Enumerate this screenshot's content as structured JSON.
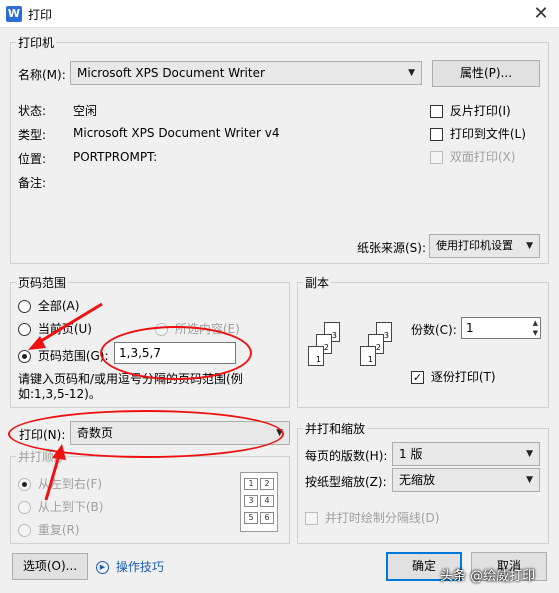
{
  "window": {
    "title": "打印",
    "app_icon": "W"
  },
  "printer": {
    "group_label": "打印机",
    "name_label": "名称(M):",
    "name_value": "Microsoft XPS Document Writer",
    "properties_btn": "属性(P)...",
    "status_label": "状态:",
    "status_value": "空闲",
    "type_label": "类型:",
    "type_value": "Microsoft XPS Document Writer v4",
    "location_label": "位置:",
    "location_value": "PORTPROMPT:",
    "comment_label": "备注:",
    "reverse_print": "反片打印(I)",
    "print_to_file": "打印到文件(L)",
    "duplex": "双面打印(X)",
    "paper_source_label": "纸张来源(S):",
    "paper_source_value": "使用打印机设置"
  },
  "page_range": {
    "group_label": "页码范围",
    "all": "全部(A)",
    "current": "当前页(U)",
    "selection": "所选内容(E)",
    "pages": "页码范围(G):",
    "pages_value": "1,3,5,7",
    "hint": "请键入页码和/或用逗号分隔的页码范围(例如:1,3,5-12)。"
  },
  "print_what": {
    "label": "打印(N):",
    "value": "奇数页"
  },
  "collate_order": {
    "group_label": "并打顺序",
    "left_to_right": "从左到右(F)",
    "top_to_bottom": "从上到下(B)",
    "repeat": "重复(R)",
    "preview_cells": [
      "1",
      "2",
      "3",
      "4",
      "5",
      "6"
    ]
  },
  "copies": {
    "group_label": "副本",
    "count_label": "份数(C):",
    "count_value": "1",
    "collate": "逐份打印(T)",
    "page_numbers": [
      "1",
      "2",
      "3"
    ]
  },
  "zoom": {
    "group_label": "并打和缩放",
    "pages_per_sheet_label": "每页的版数(H):",
    "pages_per_sheet_value": "1 版",
    "scale_label": "按纸型缩放(Z):",
    "scale_value": "无缩放",
    "draw_borders": "并打时绘制分隔线(D)"
  },
  "footer": {
    "options_btn": "选项(O)...",
    "tips_link": "操作技巧",
    "ok_btn": "确定",
    "cancel_btn": "取消",
    "watermark": "头条 @绘威打印"
  },
  "colors": {
    "accent": "#0078d7",
    "annotation_red": "#e11111"
  }
}
